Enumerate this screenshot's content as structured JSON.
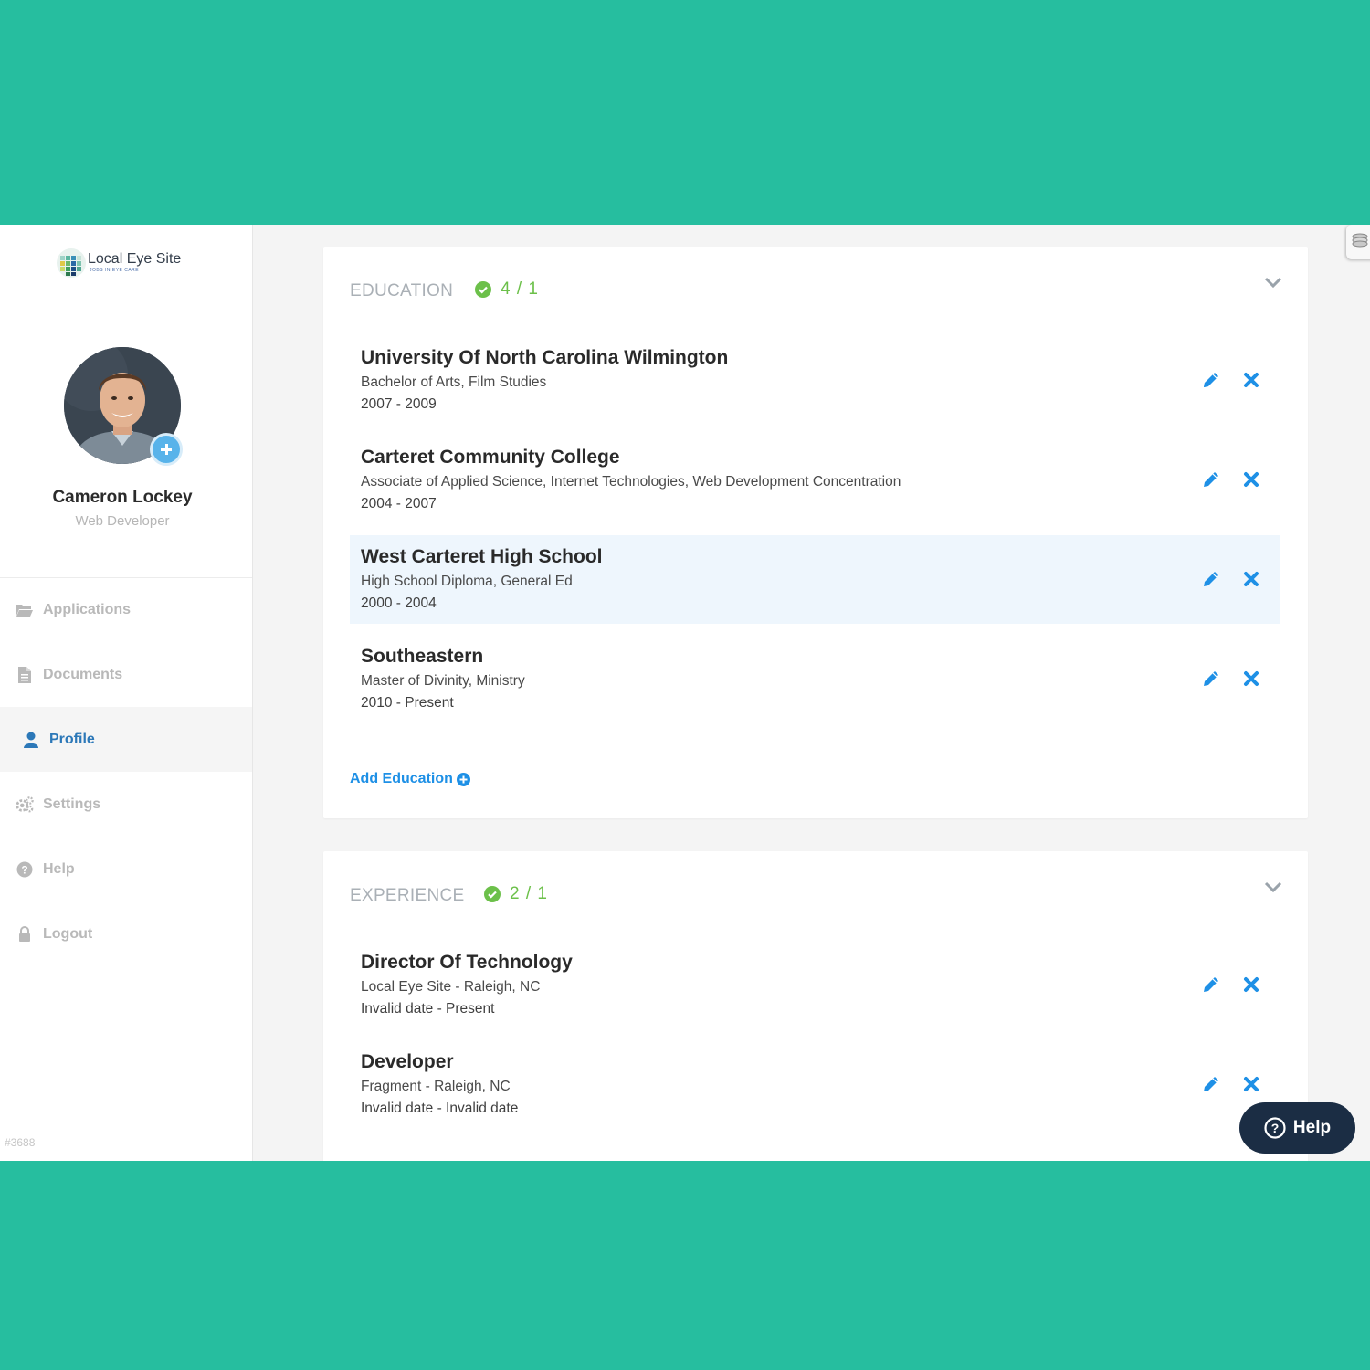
{
  "brand": {
    "name": "Local Eye Site",
    "tagline": "JOBS IN EYE CARE"
  },
  "user": {
    "name": "Cameron Lockey",
    "role": "Web Developer"
  },
  "nav": [
    {
      "label": "Applications",
      "icon": "folder-open-icon",
      "active": false
    },
    {
      "label": "Documents",
      "icon": "document-icon",
      "active": false
    },
    {
      "label": "Profile",
      "icon": "user-icon",
      "active": true
    },
    {
      "label": "Settings",
      "icon": "gears-icon",
      "active": false
    },
    {
      "label": "Help",
      "icon": "question-circle-icon",
      "active": false
    },
    {
      "label": "Logout",
      "icon": "lock-icon",
      "active": false
    }
  ],
  "build_id": "#3688",
  "education": {
    "title": "EDUCATION",
    "status": "4 / 1",
    "entries": [
      {
        "title": "University Of North Carolina Wilmington",
        "subtitle": "Bachelor of Arts, Film Studies",
        "dates": "2007 - 2009"
      },
      {
        "title": "Carteret Community College",
        "subtitle": "Associate of Applied Science, Internet Technologies, Web Development Concentration",
        "dates": "2004 - 2007"
      },
      {
        "title": "West Carteret High School",
        "subtitle": "High School Diploma, General Ed",
        "dates": "2000 - 2004"
      },
      {
        "title": "Southeastern",
        "subtitle": "Master of Divinity, Ministry",
        "dates": "2010 - Present"
      }
    ],
    "add_label": "Add Education"
  },
  "experience": {
    "title": "EXPERIENCE",
    "status": "2 / 1",
    "entries": [
      {
        "title": "Director Of Technology",
        "subtitle": "Local Eye Site - Raleigh, NC",
        "dates": "Invalid date - Present"
      },
      {
        "title": "Developer",
        "subtitle": "Fragment - Raleigh, NC",
        "dates": "Invalid date - Invalid date"
      }
    ]
  },
  "help_button": {
    "label": "Help"
  },
  "colors": {
    "background": "#26be9f",
    "accent": "#1e90e6",
    "success": "#6cc04a",
    "active_nav": "#2c78b8",
    "help_button": "#1b2d44"
  }
}
